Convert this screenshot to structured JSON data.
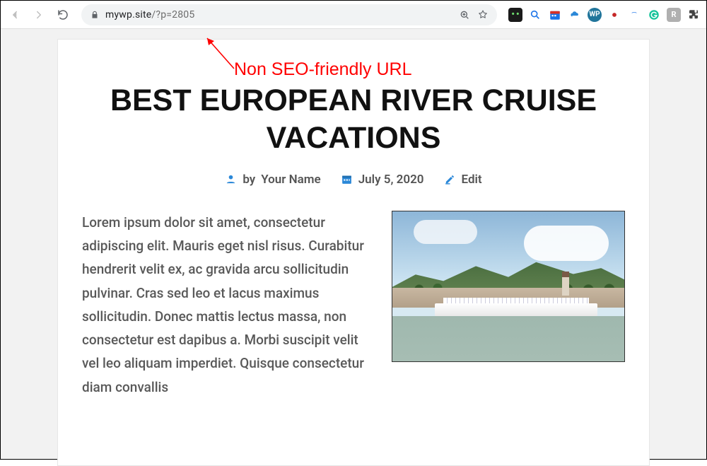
{
  "browser": {
    "url_host": "mywp.site",
    "url_path": "/?p=2805"
  },
  "annotation": {
    "label": "Non SEO-friendly URL"
  },
  "post": {
    "title": "BEST EUROPEAN RIVER CRUISE VACATIONS",
    "byline_prefix": "by",
    "author": "Your Name",
    "date": "July 5, 2020",
    "edit_label": "Edit",
    "body": "Lorem ipsum dolor sit amet, consectetur adipiscing elit. Mauris eget nisl risus. Curabitur hendrerit velit ex, ac gravida arcu sollicitudin pulvinar. Cras sed leo et lacus maximus sollicitudin. Donec mattis lectus massa, non consectetur est dapibus a. Morbi suscipit velit vel leo aliquam imperdiet. Quisque consectetur diam convallis"
  }
}
